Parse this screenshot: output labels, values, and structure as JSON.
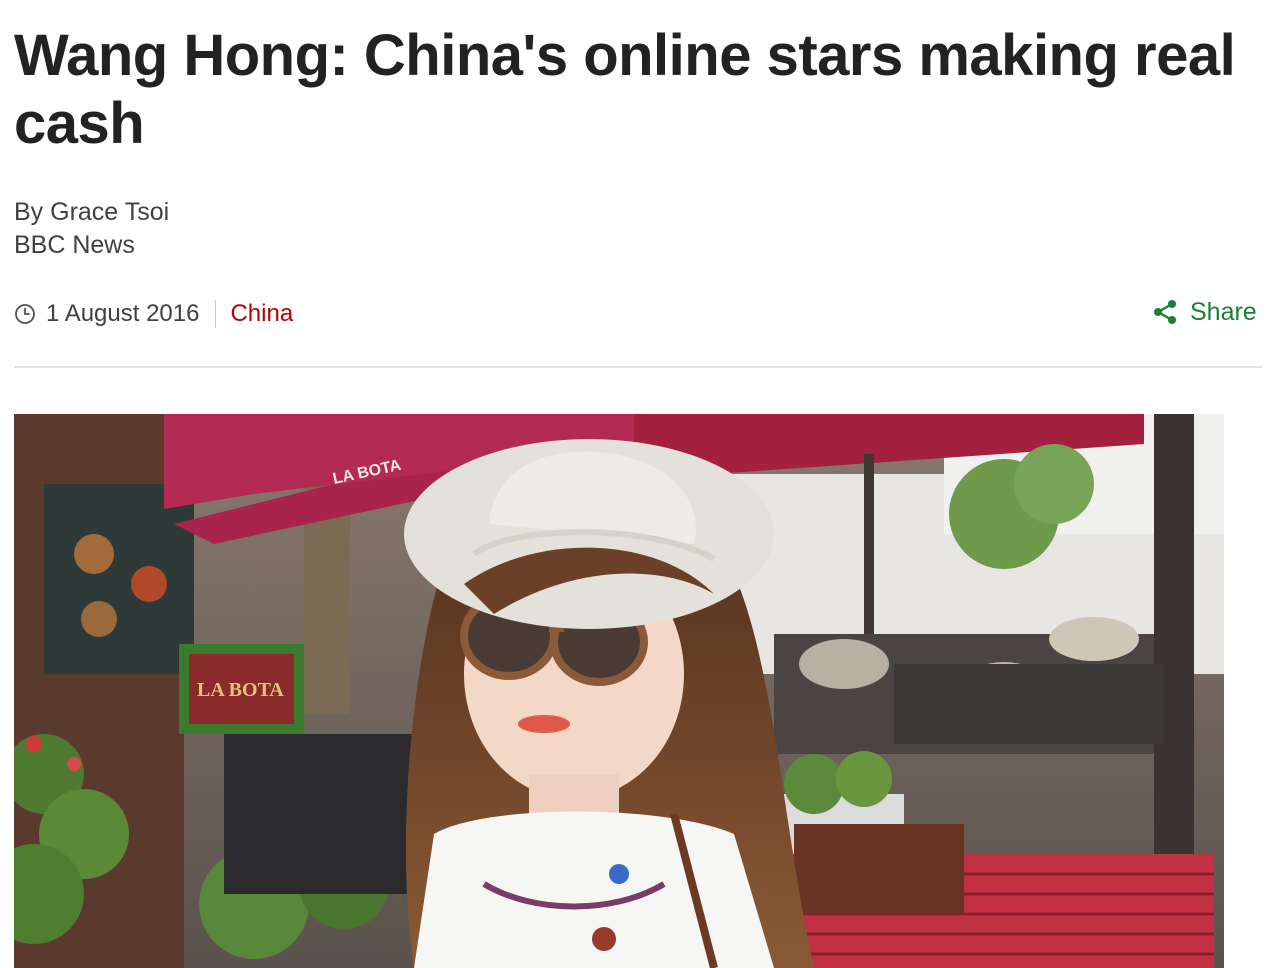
{
  "article": {
    "headline": "Wang Hong: China's online stars making real cash",
    "byline": {
      "author": "By Grace Tsoi",
      "organization": "BBC News"
    },
    "meta": {
      "date": "1 August 2016",
      "section": "China",
      "clock_icon": "clock-icon"
    },
    "share": {
      "label": "Share",
      "icon": "share-icon"
    },
    "image": {
      "umbrella_text": "LA BOTA",
      "sign_text": "LA BOTA"
    }
  },
  "colors": {
    "headline": "#222222",
    "section_link": "#b80000",
    "share": "#1a7f37",
    "rule": "#e2e2e2"
  }
}
